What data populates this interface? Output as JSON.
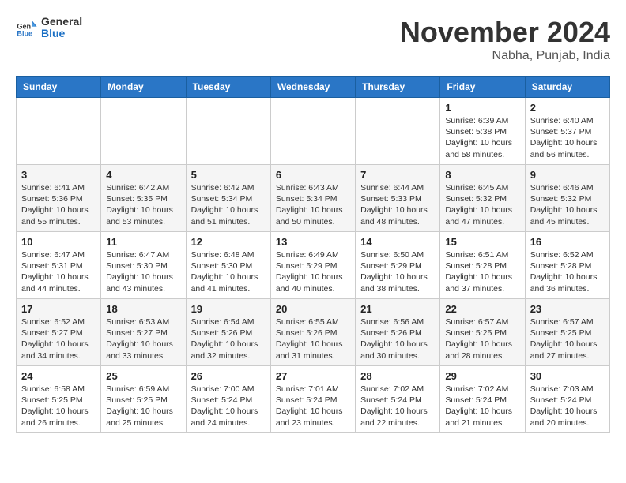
{
  "logo": {
    "general": "General",
    "blue": "Blue"
  },
  "title": "November 2024",
  "location": "Nabha, Punjab, India",
  "days_header": [
    "Sunday",
    "Monday",
    "Tuesday",
    "Wednesday",
    "Thursday",
    "Friday",
    "Saturday"
  ],
  "weeks": [
    [
      {
        "day": "",
        "info": ""
      },
      {
        "day": "",
        "info": ""
      },
      {
        "day": "",
        "info": ""
      },
      {
        "day": "",
        "info": ""
      },
      {
        "day": "",
        "info": ""
      },
      {
        "day": "1",
        "info": "Sunrise: 6:39 AM\nSunset: 5:38 PM\nDaylight: 10 hours and 58 minutes."
      },
      {
        "day": "2",
        "info": "Sunrise: 6:40 AM\nSunset: 5:37 PM\nDaylight: 10 hours and 56 minutes."
      }
    ],
    [
      {
        "day": "3",
        "info": "Sunrise: 6:41 AM\nSunset: 5:36 PM\nDaylight: 10 hours and 55 minutes."
      },
      {
        "day": "4",
        "info": "Sunrise: 6:42 AM\nSunset: 5:35 PM\nDaylight: 10 hours and 53 minutes."
      },
      {
        "day": "5",
        "info": "Sunrise: 6:42 AM\nSunset: 5:34 PM\nDaylight: 10 hours and 51 minutes."
      },
      {
        "day": "6",
        "info": "Sunrise: 6:43 AM\nSunset: 5:34 PM\nDaylight: 10 hours and 50 minutes."
      },
      {
        "day": "7",
        "info": "Sunrise: 6:44 AM\nSunset: 5:33 PM\nDaylight: 10 hours and 48 minutes."
      },
      {
        "day": "8",
        "info": "Sunrise: 6:45 AM\nSunset: 5:32 PM\nDaylight: 10 hours and 47 minutes."
      },
      {
        "day": "9",
        "info": "Sunrise: 6:46 AM\nSunset: 5:32 PM\nDaylight: 10 hours and 45 minutes."
      }
    ],
    [
      {
        "day": "10",
        "info": "Sunrise: 6:47 AM\nSunset: 5:31 PM\nDaylight: 10 hours and 44 minutes."
      },
      {
        "day": "11",
        "info": "Sunrise: 6:47 AM\nSunset: 5:30 PM\nDaylight: 10 hours and 43 minutes."
      },
      {
        "day": "12",
        "info": "Sunrise: 6:48 AM\nSunset: 5:30 PM\nDaylight: 10 hours and 41 minutes."
      },
      {
        "day": "13",
        "info": "Sunrise: 6:49 AM\nSunset: 5:29 PM\nDaylight: 10 hours and 40 minutes."
      },
      {
        "day": "14",
        "info": "Sunrise: 6:50 AM\nSunset: 5:29 PM\nDaylight: 10 hours and 38 minutes."
      },
      {
        "day": "15",
        "info": "Sunrise: 6:51 AM\nSunset: 5:28 PM\nDaylight: 10 hours and 37 minutes."
      },
      {
        "day": "16",
        "info": "Sunrise: 6:52 AM\nSunset: 5:28 PM\nDaylight: 10 hours and 36 minutes."
      }
    ],
    [
      {
        "day": "17",
        "info": "Sunrise: 6:52 AM\nSunset: 5:27 PM\nDaylight: 10 hours and 34 minutes."
      },
      {
        "day": "18",
        "info": "Sunrise: 6:53 AM\nSunset: 5:27 PM\nDaylight: 10 hours and 33 minutes."
      },
      {
        "day": "19",
        "info": "Sunrise: 6:54 AM\nSunset: 5:26 PM\nDaylight: 10 hours and 32 minutes."
      },
      {
        "day": "20",
        "info": "Sunrise: 6:55 AM\nSunset: 5:26 PM\nDaylight: 10 hours and 31 minutes."
      },
      {
        "day": "21",
        "info": "Sunrise: 6:56 AM\nSunset: 5:26 PM\nDaylight: 10 hours and 30 minutes."
      },
      {
        "day": "22",
        "info": "Sunrise: 6:57 AM\nSunset: 5:25 PM\nDaylight: 10 hours and 28 minutes."
      },
      {
        "day": "23",
        "info": "Sunrise: 6:57 AM\nSunset: 5:25 PM\nDaylight: 10 hours and 27 minutes."
      }
    ],
    [
      {
        "day": "24",
        "info": "Sunrise: 6:58 AM\nSunset: 5:25 PM\nDaylight: 10 hours and 26 minutes."
      },
      {
        "day": "25",
        "info": "Sunrise: 6:59 AM\nSunset: 5:25 PM\nDaylight: 10 hours and 25 minutes."
      },
      {
        "day": "26",
        "info": "Sunrise: 7:00 AM\nSunset: 5:24 PM\nDaylight: 10 hours and 24 minutes."
      },
      {
        "day": "27",
        "info": "Sunrise: 7:01 AM\nSunset: 5:24 PM\nDaylight: 10 hours and 23 minutes."
      },
      {
        "day": "28",
        "info": "Sunrise: 7:02 AM\nSunset: 5:24 PM\nDaylight: 10 hours and 22 minutes."
      },
      {
        "day": "29",
        "info": "Sunrise: 7:02 AM\nSunset: 5:24 PM\nDaylight: 10 hours and 21 minutes."
      },
      {
        "day": "30",
        "info": "Sunrise: 7:03 AM\nSunset: 5:24 PM\nDaylight: 10 hours and 20 minutes."
      }
    ]
  ]
}
